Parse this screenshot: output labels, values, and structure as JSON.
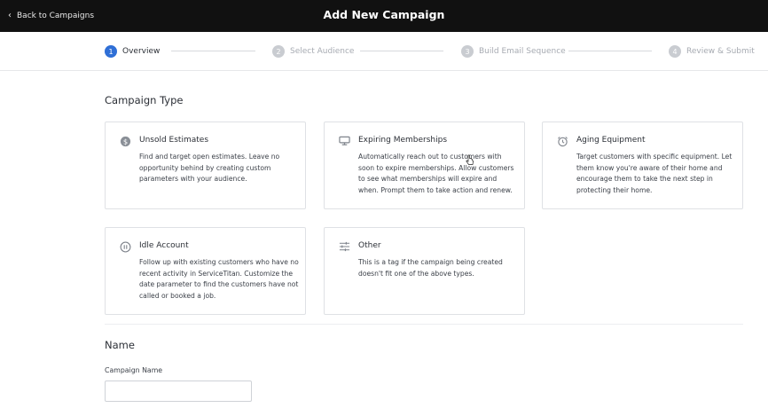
{
  "header": {
    "back_label": "Back to Campaigns",
    "title": "Add New Campaign"
  },
  "stepper": {
    "steps": [
      {
        "num": "1",
        "label": "Overview",
        "active": true
      },
      {
        "num": "2",
        "label": "Select Audience",
        "active": false
      },
      {
        "num": "3",
        "label": "Build Email Sequence",
        "active": false
      },
      {
        "num": "4",
        "label": "Review & Submit",
        "active": false
      }
    ]
  },
  "campaign_type": {
    "heading": "Campaign Type",
    "cards": [
      {
        "icon": "dollar-circle-icon",
        "title": "Unsold Estimates",
        "description": "Find and target open estimates. Leave no opportunity behind by creating custom parameters with your audience."
      },
      {
        "icon": "monitor-icon",
        "title": "Expiring Memberships",
        "description": "Automatically reach out to customers with soon to expire memberships. Allow customers to see what memberships will expire and when. Prompt them to take action and renew."
      },
      {
        "icon": "alarm-clock-icon",
        "title": "Aging Equipment",
        "description": "Target customers with specific equipment. Let them know you're aware of their home and encourage them to take the next step in protecting their home."
      },
      {
        "icon": "pause-circle-icon",
        "title": "Idle Account",
        "description": "Follow up with existing customers who have no recent activity in ServiceTitan. Customize the date parameter to find the customers have not called or booked a job."
      },
      {
        "icon": "sliders-icon",
        "title": "Other",
        "description": "This is a tag if the campaign being created doesn't fit one of the above types."
      }
    ]
  },
  "name_section": {
    "heading": "Name",
    "field_label": "Campaign Name",
    "field_value": "",
    "field_placeholder": ""
  },
  "colors": {
    "topbar": "#111111",
    "accent": "#2f6fd6",
    "border": "#dfe1e5"
  }
}
